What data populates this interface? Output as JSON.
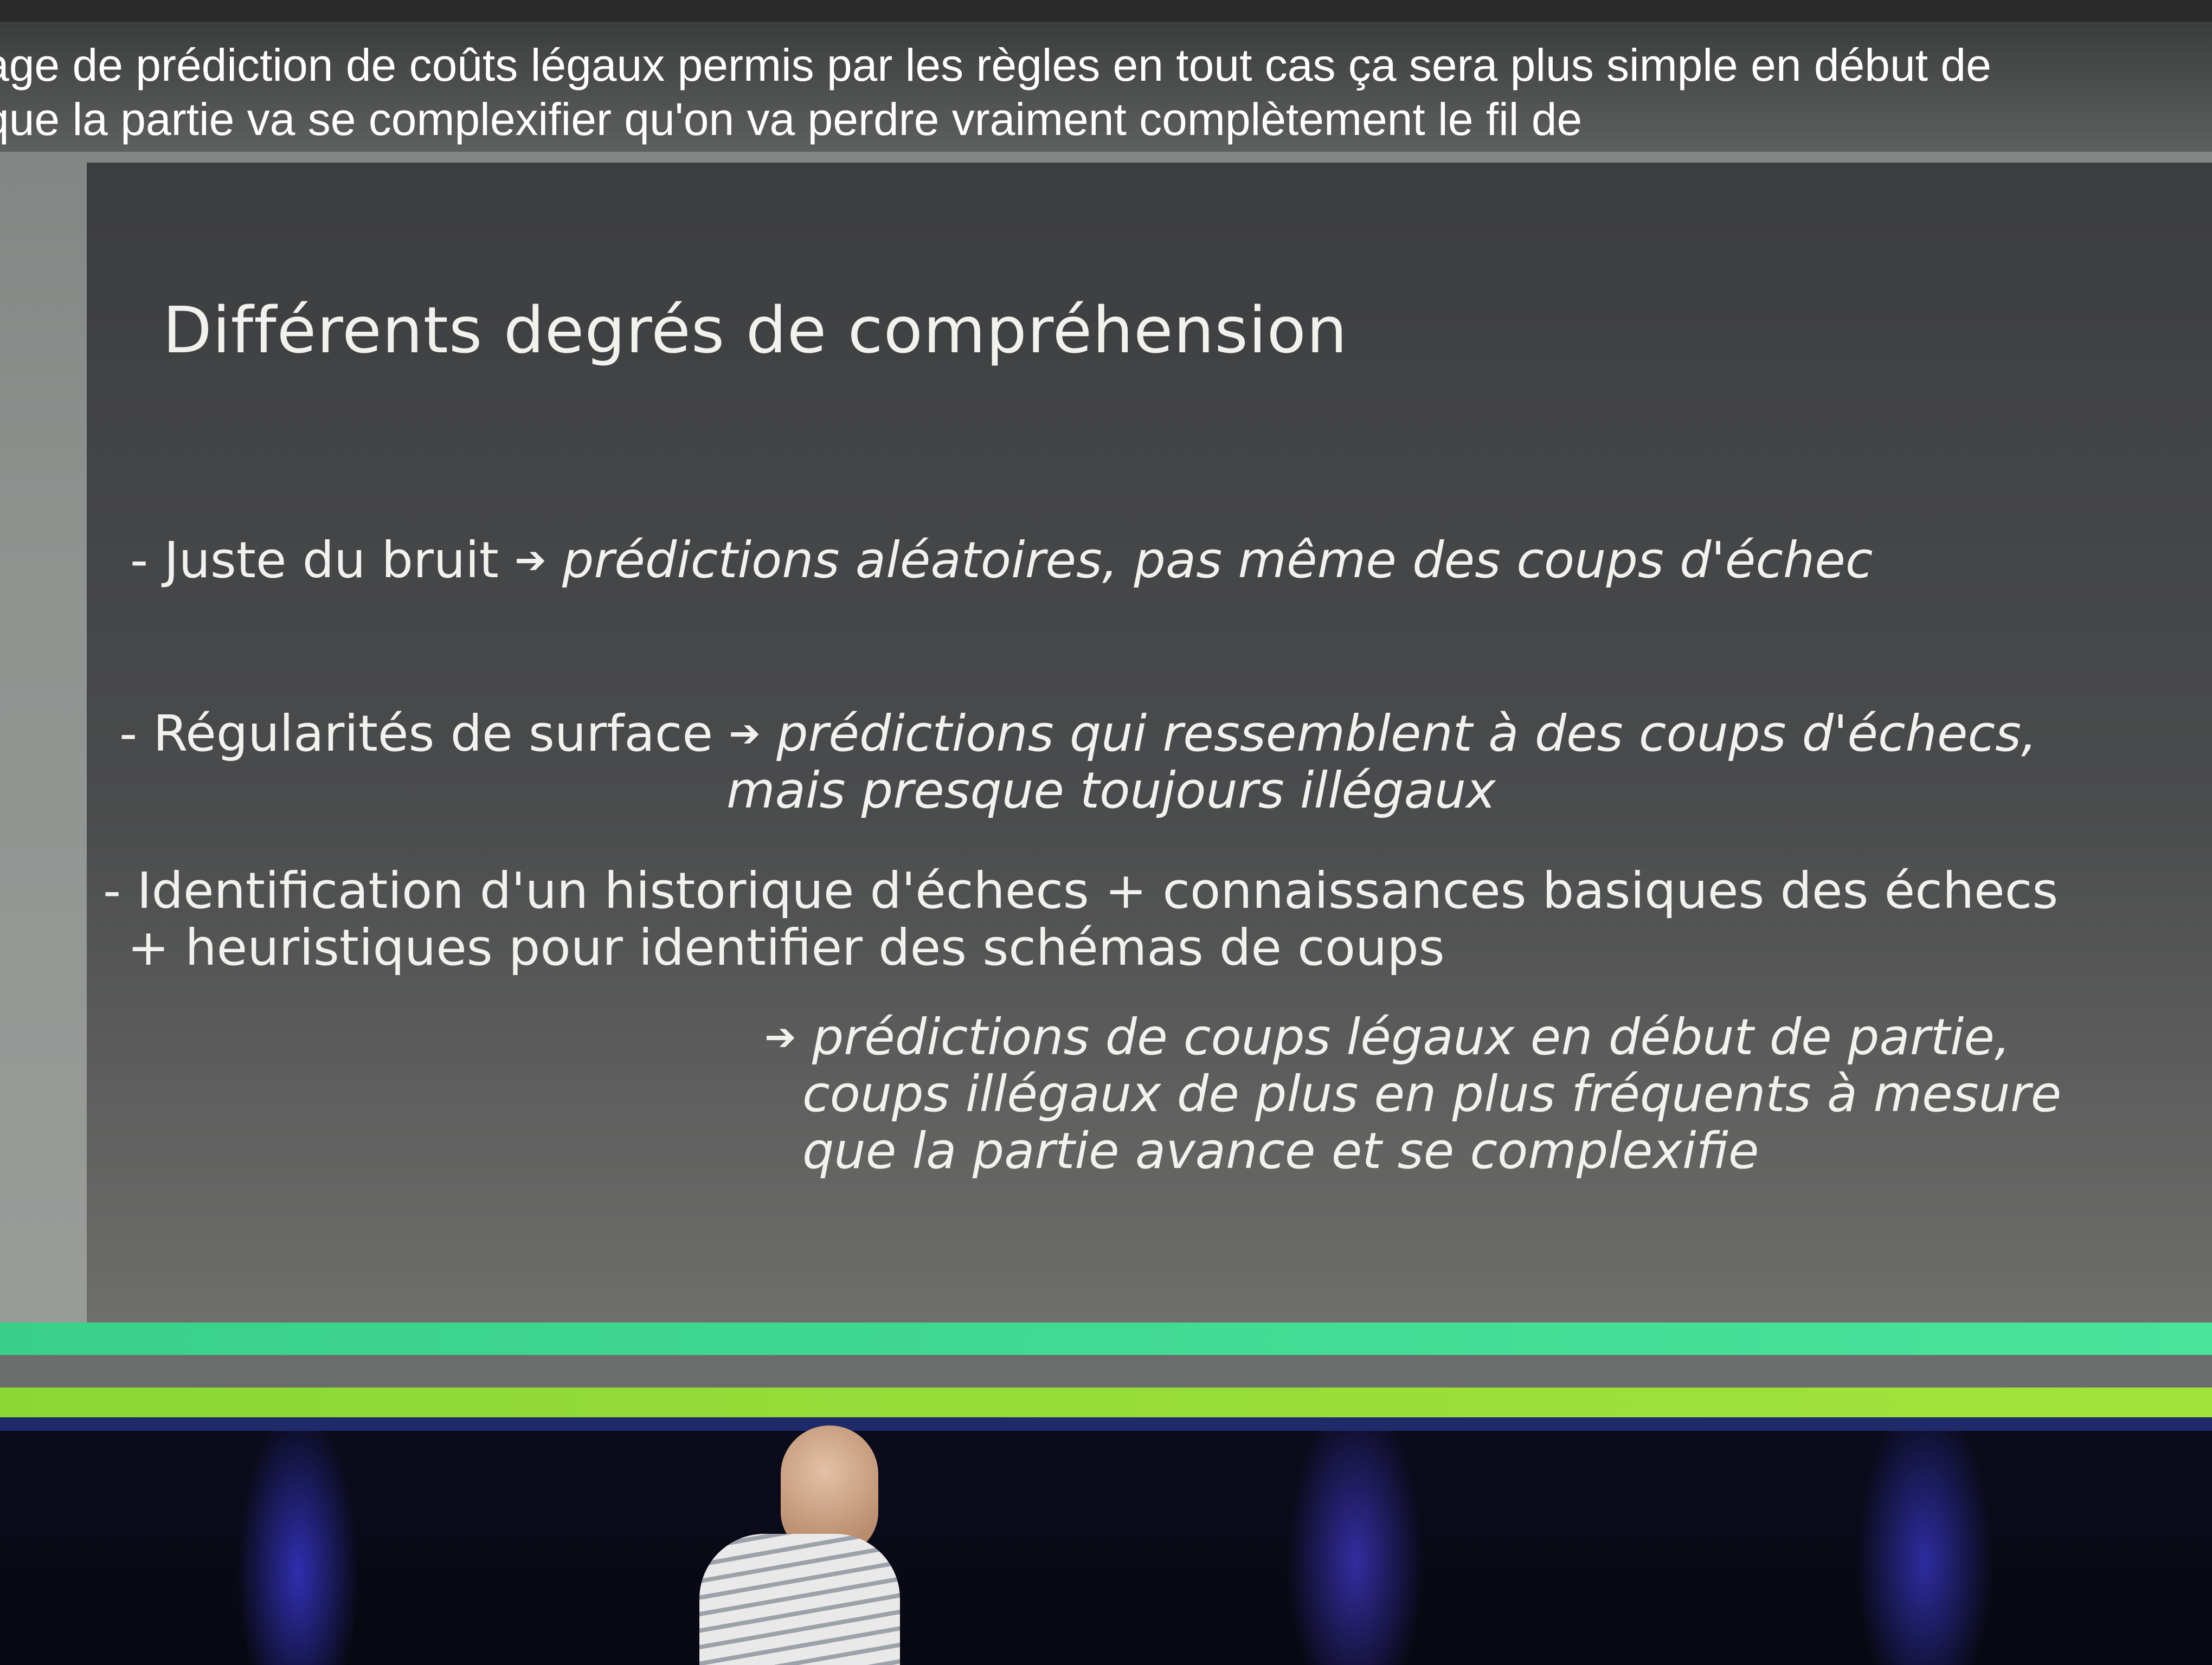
{
  "captions": {
    "line1": "age de prédiction de coûts légaux permis par les règles en tout cas ça sera plus simple en début de",
    "line2": "que la partie va se complexifier qu'on va perdre vraiment complètement le fil de"
  },
  "slide": {
    "title": "Différents degrés de compréhension",
    "arrow": "➔",
    "items": [
      {
        "label": "- Juste du bruit",
        "result": "prédictions aléatoires, pas même des coups d'échec"
      },
      {
        "label": "- Régularités de surface",
        "result": "prédictions qui ressemblent à des coups d'échecs,",
        "result_cont": "mais presque toujours illégaux"
      },
      {
        "label": "- Identification d'un historique d'échecs + connaissances basiques des échecs",
        "label_cont": "+ heuristiques pour identifier des schémas de coups",
        "result": "prédictions de coups légaux en début de partie,",
        "result_cont": "coups illégaux de plus en plus fréquents à mesure",
        "result_cont2": "que la partie avance et se complexifie"
      }
    ]
  },
  "colors": {
    "accent_green": "#49e39a",
    "accent_lime": "#a3e23b",
    "slide_bg": "#444547",
    "stage_light": "#3c3ce6"
  }
}
